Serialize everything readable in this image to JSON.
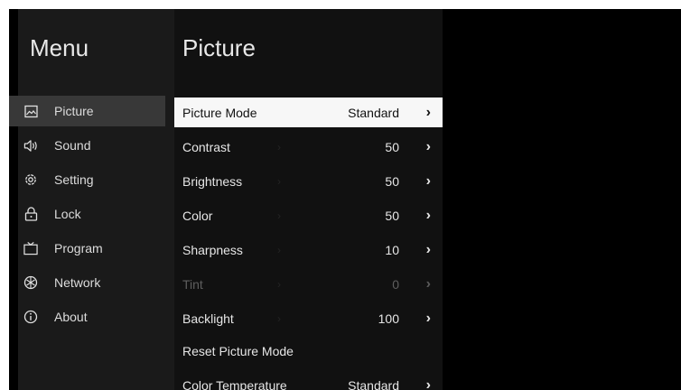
{
  "menu": {
    "title": "Menu",
    "items": [
      {
        "label": "Picture",
        "icon": "picture-icon",
        "selected": true
      },
      {
        "label": "Sound",
        "icon": "speaker-icon"
      },
      {
        "label": "Setting",
        "icon": "gear-icon"
      },
      {
        "label": "Lock",
        "icon": "lock-icon"
      },
      {
        "label": "Program",
        "icon": "tv-icon"
      },
      {
        "label": "Network",
        "icon": "network-icon"
      },
      {
        "label": "About",
        "icon": "info-icon"
      }
    ]
  },
  "picture": {
    "title": "Picture",
    "rows": [
      {
        "label": "Picture Mode",
        "value": "Standard",
        "selected": true,
        "chevron": "chevron-right-icon"
      },
      {
        "label": "Contrast",
        "value": "50",
        "chevron": "chevron-right-icon"
      },
      {
        "label": "Brightness",
        "value": "50",
        "chevron": "chevron-right-icon"
      },
      {
        "label": "Color",
        "value": "50",
        "chevron": "chevron-right-icon"
      },
      {
        "label": "Sharpness",
        "value": "10",
        "chevron": "chevron-right-icon"
      },
      {
        "label": "Tint",
        "value": "0",
        "disabled": true,
        "chevron": "chevron-right-icon"
      },
      {
        "label": "Backlight",
        "value": "100",
        "chevron": "chevron-right-icon"
      },
      {
        "label": "Reset Picture Mode"
      },
      {
        "label": "Color Temperature",
        "value": "Standard",
        "chevron": "chevron-right-icon"
      }
    ]
  },
  "colors": {
    "selected_row_bg": "#f7f7f7",
    "selected_nav_bg": "#383838",
    "disabled_text": "#5e5e5e"
  }
}
